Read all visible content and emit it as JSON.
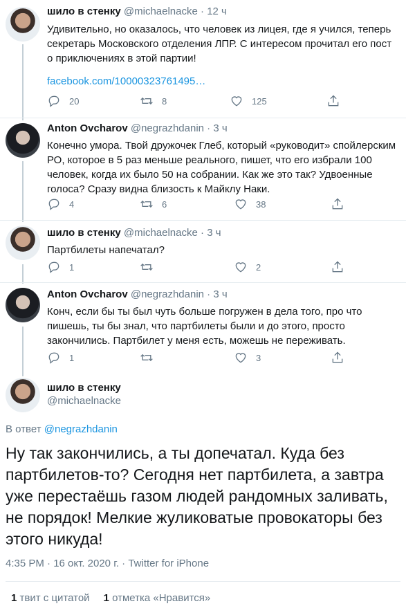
{
  "tweets": [
    {
      "name": "шило в стенку",
      "handle": "@michaelnacke",
      "time": "12 ч",
      "text": "Удивительно, но оказалось, что человек из лицея, где я учился, теперь секретарь Московского отделения ЛПР. С интересом прочитал его пост о приключениях в этой партии!",
      "link": "facebook.com/10000323761495…",
      "replies": "20",
      "retweets": "8",
      "likes": "125"
    },
    {
      "name": "Anton Ovcharov",
      "handle": "@negrazhdanin",
      "time": "3 ч",
      "text": "Конечно умора. Твой дружочек Глеб, который «руководит» спойлерским РО, которое в 5 раз меньше реального, пишет, что его избрали 100 человек, когда их было 50 на собрании. Как же это так? Удвоенные голоса? Сразу видна близость к Майклу Наки.",
      "replies": "4",
      "retweets": "6",
      "likes": "38"
    },
    {
      "name": "шило в стенку",
      "handle": "@michaelnacke",
      "time": "3 ч",
      "text": "Партбилеты напечатал?",
      "replies": "1",
      "retweets": "",
      "likes": "2"
    },
    {
      "name": "Anton Ovcharov",
      "handle": "@negrazhdanin",
      "time": "3 ч",
      "text": "Конч, если бы ты был чуть больше погружен в дела того, про что пишешь, ты бы знал, что партбилеты были и до этого, просто закончились. Партбилет у меня есть, можешь не переживать.",
      "replies": "1",
      "retweets": "",
      "likes": "3"
    }
  ],
  "main": {
    "name": "шило в стенку",
    "handle": "@michaelnacke",
    "reply_prefix": "В ответ",
    "reply_to": "@negrazhdanin",
    "text": "Ну так закончились, а ты допечатал. Куда без партбилетов-то? Сегодня нет партбилета, а завтра уже перестаёшь газом людей рандомных заливать, не порядок! Мелкие жуликоватые провокаторы без этого никуда!",
    "meta": "4:35 PM · 16 окт. 2020 г. · Twitter for iPhone",
    "quote_count": "1",
    "quote_label": "твит с цитатой",
    "like_count": "1",
    "like_label": "отметка «Нравится»"
  },
  "colors": {
    "link": "#1b95e0",
    "secondary": "#657786",
    "primary": "#14171a"
  },
  "icons": [
    "reply-icon",
    "retweet-icon",
    "like-icon",
    "share-icon"
  ]
}
